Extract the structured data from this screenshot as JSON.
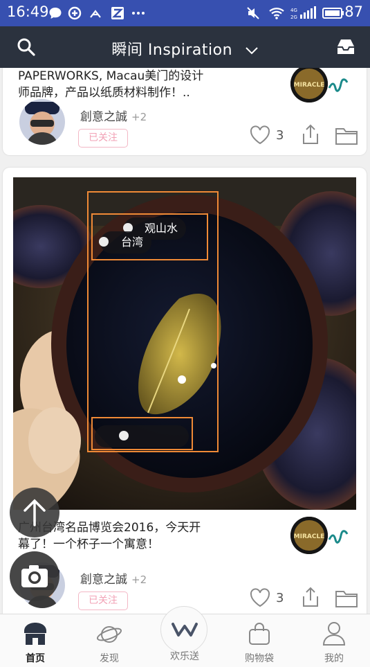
{
  "status_bar": {
    "time": "16:49",
    "battery": "87",
    "icons": [
      "chat-bubble-icon",
      "sync-icon",
      "network-icon",
      "z-app-icon",
      "more-dots-icon",
      "mute-icon",
      "wifi-icon",
      "signal-icon",
      "battery-icon"
    ]
  },
  "header": {
    "title": "瞬间 Inspiration"
  },
  "posts": [
    {
      "caption": "PAPERWORKS, Macau美门的设计师品牌，产品以纸质材料制作！..",
      "author": "創意之誠",
      "author_extra": "+2",
      "follow_label": "已关注",
      "likes": "3"
    },
    {
      "caption": "广州台湾名品博览会2016，今天开幕了！一个杯子一个寓意！",
      "author": "創意之誠",
      "author_extra": "+2",
      "follow_label": "已关注",
      "likes": "3",
      "photo_tags": [
        "观山水",
        "台湾",
        ""
      ]
    }
  ],
  "nav": {
    "items": [
      {
        "label": "首页",
        "icon": "home-icon",
        "active": true
      },
      {
        "label": "发现",
        "icon": "planet-icon",
        "active": false
      },
      {
        "label": "欢乐送",
        "icon": "w-logo-icon",
        "active": false
      },
      {
        "label": "购物袋",
        "icon": "shopping-bag-icon",
        "active": false
      },
      {
        "label": "我的",
        "icon": "profile-icon",
        "active": false
      }
    ]
  },
  "colors": {
    "status_bar": "#3750b0",
    "header": "#2b323e",
    "follow_pink": "#f2a2b6",
    "tag_outline": "#f08a36"
  }
}
